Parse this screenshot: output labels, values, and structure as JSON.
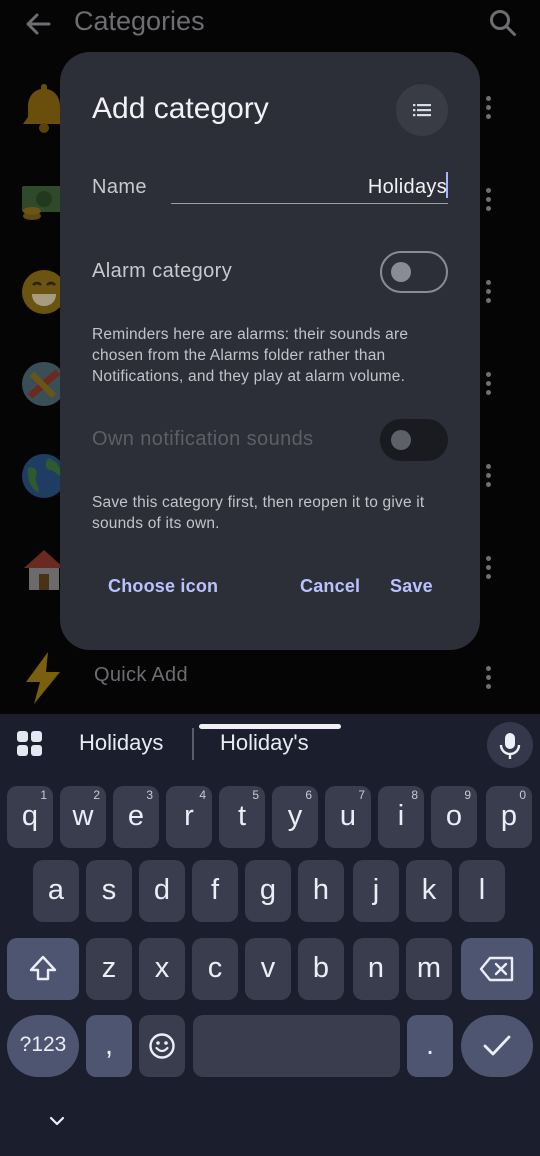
{
  "app": {
    "title": "Categories",
    "back_icon": "arrow-left-icon",
    "search_icon": "search-icon",
    "categories": [
      {
        "icon": "bell-icon",
        "label": ""
      },
      {
        "icon": "money-icon",
        "label": ""
      },
      {
        "icon": "grinning-face-icon",
        "label": ""
      },
      {
        "icon": "puzzle-globe-icon",
        "label": ""
      },
      {
        "icon": "globe-icon",
        "label": ""
      },
      {
        "icon": "house-icon",
        "label": ""
      },
      {
        "icon": "lightning-icon",
        "label": "Quick Add"
      }
    ]
  },
  "dialog": {
    "title": "Add category",
    "list_icon": "list-icon",
    "name_label": "Name",
    "name_value": "Holidays",
    "alarm_label": "Alarm category",
    "alarm_on": false,
    "alarm_desc": "Reminders here are alarms: their sounds are chosen from the Alarms folder rather than Notifications, and they play at alarm volume.",
    "sounds_label": "Own notification sounds",
    "sounds_on": false,
    "sounds_enabled": false,
    "sounds_desc": "Save this category first, then reopen it to give it sounds of its own.",
    "choose_icon": "Choose icon",
    "cancel": "Cancel",
    "save": "Save",
    "accent_color": "#b9c2ff"
  },
  "keyboard": {
    "suggestions": [
      "Holidays",
      "Holiday's"
    ],
    "row1": [
      {
        "k": "q",
        "h": "1"
      },
      {
        "k": "w",
        "h": "2"
      },
      {
        "k": "e",
        "h": "3"
      },
      {
        "k": "r",
        "h": "4"
      },
      {
        "k": "t",
        "h": "5"
      },
      {
        "k": "y",
        "h": "6"
      },
      {
        "k": "u",
        "h": "7"
      },
      {
        "k": "i",
        "h": "8"
      },
      {
        "k": "o",
        "h": "9"
      },
      {
        "k": "p",
        "h": "0"
      }
    ],
    "row2": [
      "a",
      "s",
      "d",
      "f",
      "g",
      "h",
      "j",
      "k",
      "l"
    ],
    "row3": [
      "z",
      "x",
      "c",
      "v",
      "b",
      "n",
      "m"
    ],
    "symbols_key": "?123",
    "comma_key": ",",
    "period_key": ".",
    "icons": {
      "apps": "grid-icon",
      "mic": "microphone-icon",
      "shift": "shift-icon",
      "backspace": "backspace-icon",
      "emoji": "emoji-icon",
      "enter": "checkmark-icon",
      "hide": "chevron-down-icon"
    }
  }
}
